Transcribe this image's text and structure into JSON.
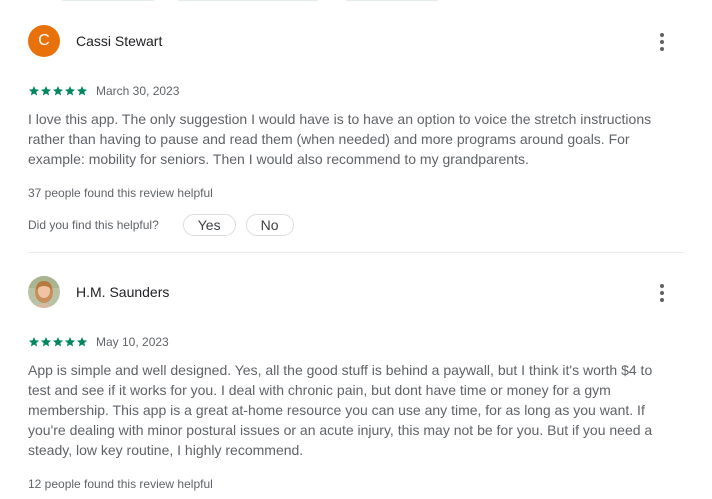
{
  "colors": {
    "star": "#01875f",
    "avatar_letter_bg": "#e8710a",
    "text_primary": "#202124",
    "text_secondary": "#5f6368",
    "divider": "#e8eaed"
  },
  "reviews": [
    {
      "avatar_letter": "C",
      "reviewer_name": "Cassi Stewart",
      "rating": 5,
      "date": "March 30, 2023",
      "text": "I love this app. The only suggestion I would have is to have an option to voice the stretch instructions rather than having to pause and read them (when needed) and more programs around goals. For example: mobility for seniors. Then I would also recommend to my grandparents.",
      "helpful_count_text": "37 people found this review helpful",
      "helpful_prompt": "Did you find this helpful?",
      "yes_label": "Yes",
      "no_label": "No",
      "more_icon": "more-vert-icon"
    },
    {
      "avatar_letter": "",
      "reviewer_name": "H.M. Saunders",
      "rating": 5,
      "date": "May 10, 2023",
      "text": "App is simple and well designed. Yes, all the good stuff is behind a paywall, but I think it's worth $4 to test and see if it works for you. I deal with chronic pain, but dont have time or money for a gym membership. This app is a great at-home resource you can use any time, for as long as you want. If you're dealing with minor postural issues or an acute injury, this may not be for you. But if you need a steady, low key routine, I highly recommend.",
      "helpful_count_text": "12 people found this review helpful",
      "more_icon": "more-vert-icon"
    }
  ]
}
